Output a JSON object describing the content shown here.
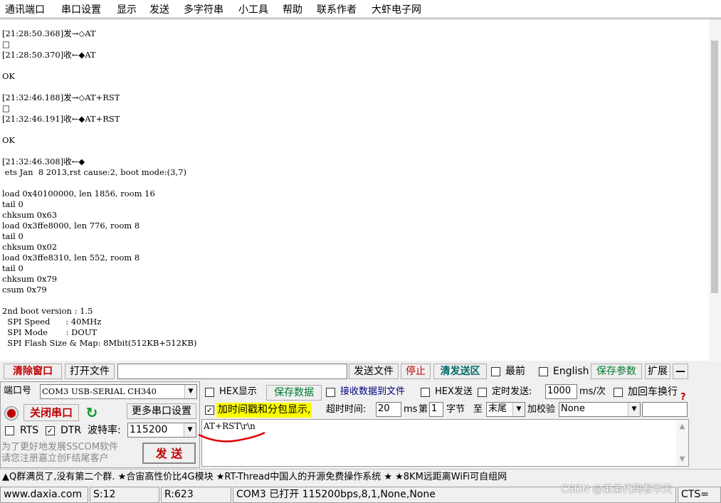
{
  "menu": [
    "通讯端口",
    "串口设置",
    "显示",
    "发送",
    "多字符串",
    "小工具",
    "帮助",
    "联系作者",
    "大虾电子网"
  ],
  "log_lines": [
    "[21:28:50.368]发→◇AT",
    "□",
    "[21:28:50.370]收←◆AT",
    "",
    "OK",
    "",
    "[21:32:46.188]发→◇AT+RST",
    "□",
    "[21:32:46.191]收←◆AT+RST",
    "",
    "OK",
    "",
    "[21:32:46.308]收←◆",
    " ets Jan  8 2013,rst cause:2, boot mode:(3,7)",
    "",
    "load 0x40100000, len 1856, room 16",
    "tail 0",
    "chksum 0x63",
    "load 0x3ffe8000, len 776, room 8",
    "tail 0",
    "chksum 0x02",
    "load 0x3ffe8310, len 552, room 8",
    "tail 0",
    "chksum 0x79",
    "csum 0x79",
    "",
    "2nd boot version : 1.5",
    "  SPI Speed      : 40MHz",
    "  SPI Mode       : DOUT",
    "  SPI Flash Size & Map: 8Mbit(512KB+512KB)"
  ],
  "toolbar": {
    "clear_window": "清除窗口",
    "open_file": "打开文件",
    "file_path": "",
    "send_file": "发送文件",
    "stop": "停止",
    "clear_send": "清发送区",
    "topmost": "最前",
    "english": "English",
    "save_params": "保存参数",
    "expand": "扩展",
    "collapse": "—"
  },
  "port": {
    "label": "端口号",
    "value": "COM3 USB-SERIAL CH340",
    "close_port": "关闭串口",
    "more_settings": "更多串口设置",
    "rts": "RTS",
    "dtr": "DTR",
    "baud_label": "波特率:",
    "baud_value": "115200",
    "promo_line1": "为了更好地发展SSCOM软件",
    "promo_line2": "请您注册嘉立创F结尾客户",
    "send": "发 送"
  },
  "options": {
    "hex_display": "HEX显示",
    "save_data": "保存数据",
    "recv_to_file": "接收数据到文件",
    "hex_send": "HEX发送",
    "timed_send": "定时发送:",
    "interval": "1000",
    "interval_unit": "ms/次",
    "append_crlf": "加回车换行",
    "timestamp": "加时间戳和分包显示,",
    "timeout_label": "超时时间:",
    "timeout": "20",
    "ms": "ms",
    "nth": "第",
    "byte_index": "1",
    "byte_unit": "字节",
    "to": "至",
    "end": "末尾",
    "checksum_label": "加校验",
    "checksum": "None",
    "help": "?"
  },
  "send_text": "AT+RST\\r\\n",
  "ad": "▲Q群满员了,没有第二个群. ★合宙高性价比4G模块 ★RT-Thread中国人的开源免费操作系统 ★ ★8KM远距离WiFi可自组网",
  "statusbar": {
    "site": "www.daxia.com",
    "sent": "S:12",
    "received": "R:623",
    "port_status": "COM3 已打开  115200bps,8,1,None,None",
    "cts": "CTS="
  },
  "watermark": "CSDN @弟弟代码看半天",
  "colors": {
    "accent_red": "#c00000",
    "accent_green": "#007a2e",
    "highlight_yellow": "#ffff00",
    "annotation_red": "#e00000"
  }
}
